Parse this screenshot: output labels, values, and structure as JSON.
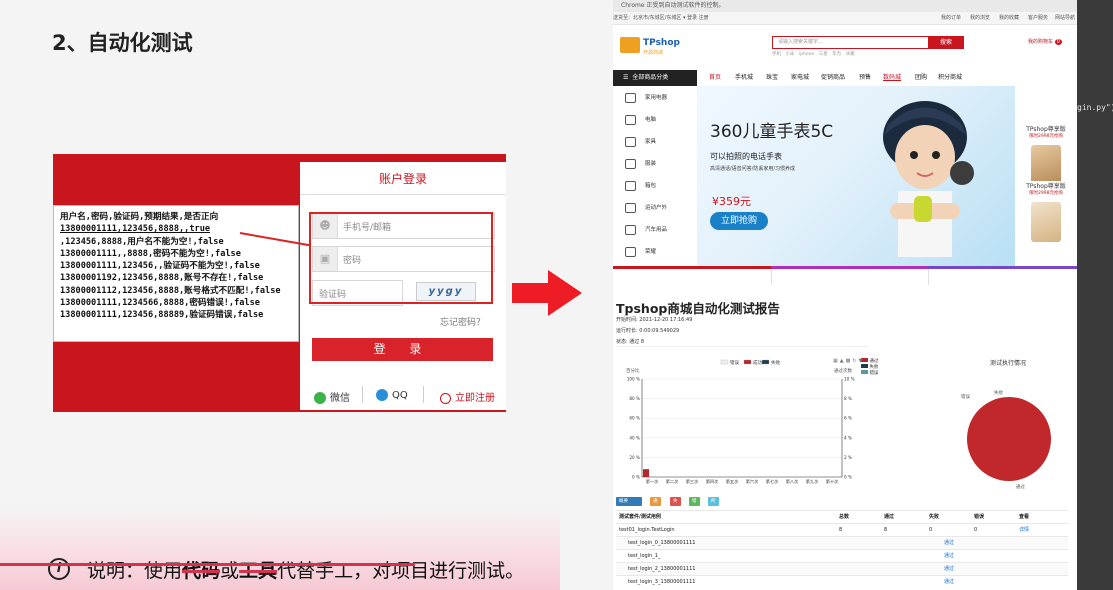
{
  "slide": {
    "title": "2、自动化测试",
    "note_icon": "i",
    "note_prefix": "说明：使用",
    "note_bold1": "代码",
    "note_mid": "或",
    "note_bold2": "工具",
    "note_suffix": "代替手工，对项目进行测试。"
  },
  "login": {
    "title": "账户登录",
    "username_placeholder": "手机号/邮箱",
    "password_placeholder": "密码",
    "captcha_placeholder": "验证码",
    "captcha_text": "yygy",
    "forgot": "忘记密码？",
    "submit": "登 录",
    "wechat": "微信",
    "qq": "QQ",
    "register": "立即注册"
  },
  "test_data": {
    "lines": [
      "用户名,密码,验证码,预期结果,是否正向",
      "13800001111,123456,8888,,true",
      ",123456,8888,用户名不能为空!,false",
      "13800001111,,8888,密码不能为空!,false",
      "13800001111,123456,,验证码不能为空!,false",
      "13800001192,123456,8888,账号不存在!,false",
      "13800001112,123456,8888,账号格式不匹配!,false",
      "13800001111,1234566,8888,密码错误!,false",
      "13800001111,123456,88889,验证码错误,false"
    ]
  },
  "browser": {
    "chrome_notice": "Chrome 正受到自动测试软件的控制。",
    "top_left": "送货至：北京市/东城区/东城区  ▾    登录  注册",
    "top_right": [
      "我的订单",
      "我的浏览",
      "我的收藏",
      "客户服务",
      "网站导航"
    ],
    "logo": "TPshop",
    "logo_sub": "开源商城",
    "search_placeholder": "请输入搜索关键字...",
    "search_btn": "搜索",
    "hot_words": "手机  小米  iphone  三星  华为  冰箱",
    "cart": "我的购物车",
    "cart_count": "0",
    "all_categories": "全部商品分类",
    "menu": [
      "首页",
      "手机城",
      "珠宝",
      "家电城",
      "促销商品",
      "预售",
      "数码城",
      "团购",
      "积分商城"
    ],
    "categories": [
      "家用电器",
      "电脑",
      "家具",
      "服装",
      "箱包",
      "运动户外",
      "汽车用品",
      "荣耀"
    ],
    "banner_title": "360儿童手表5C",
    "banner_sub": "可以拍照的电话手表",
    "banner_sub2": "高清通话/语音问答/防丢家用/习惯养成",
    "banner_price": "¥359元",
    "banner_btn": "立即抢购",
    "side1_name": "TPshop尊享版",
    "side1_price": "限时2998元抢购",
    "side2_name": "TPshop尊享版",
    "side2_price": "限时2998元抢购",
    "code_peek": "gin.py\")"
  },
  "report": {
    "title": "Tpshop商城自动化测试报告",
    "start_time": "开始时间: 2021-12-20 17:16:49",
    "duration": "运行时长: 0:00:09.549029",
    "status": "状态: 通过 8",
    "legend": [
      "错误",
      "成功",
      "失败"
    ],
    "right_legend": [
      "通过",
      "失败",
      "错误"
    ],
    "y_left_label": "百分比",
    "y_right_label": "通过次数",
    "y_left_ticks": [
      "100 %",
      "80 %",
      "60 %",
      "40 %",
      "20 %",
      "0 %"
    ],
    "y_right_ticks": [
      "10 %",
      "8 %",
      "6 %",
      "4 %",
      "2 %",
      "0 %"
    ],
    "x_ticks": [
      "第一次",
      "第二次",
      "第三次",
      "第四次",
      "第五次",
      "第六次",
      "第七次",
      "第八次",
      "第九次",
      "第十次"
    ],
    "pie_title": "测试执行情况",
    "pie_labels": [
      "失败",
      "错误",
      "通过"
    ],
    "badges": [
      "概要 100.00%",
      "通过 8",
      "失败 0",
      "错误 0",
      "所有 8"
    ],
    "table_header": [
      "测试套件/测试用例",
      "总数",
      "通过",
      "失败",
      "错误",
      "查看"
    ],
    "table_rows": [
      [
        "test01_login.TestLogin",
        "8",
        "8",
        "0",
        "0",
        "详情"
      ],
      [
        "test_login_0_13800001111",
        "",
        "",
        "通过",
        "",
        ""
      ],
      [
        "test_login_1_",
        "",
        "",
        "通过",
        "",
        ""
      ],
      [
        "test_login_2_13800001111",
        "",
        "",
        "通过",
        "",
        ""
      ],
      [
        "test_login_3_13800001111",
        "",
        "",
        "通过",
        "",
        ""
      ]
    ]
  },
  "chart_data": {
    "type": "bar",
    "categories": [
      "第一次",
      "第二次",
      "第三次",
      "第四次",
      "第五次",
      "第六次",
      "第七次",
      "第八次",
      "第九次",
      "第十次"
    ],
    "series": [
      {
        "name": "成功",
        "values": [
          0.8,
          null,
          null,
          null,
          null,
          null,
          null,
          null,
          null,
          null
        ]
      }
    ],
    "ylim": [
      0,
      10
    ],
    "yticks": [
      "0 %",
      "2 %",
      "4 %",
      "6 %",
      "8 %",
      "10 %"
    ],
    "ylabel": "通过次数",
    "legend": [
      "错误",
      "成功",
      "失败"
    ],
    "colors": {
      "成功": "#b5262b",
      "失败": "#233a4b",
      "错误": "#eeeeee"
    }
  },
  "colors": {
    "brand_red": "#c9151e",
    "arrow_red": "#ee1c24",
    "note_strike": "#d5334d"
  }
}
